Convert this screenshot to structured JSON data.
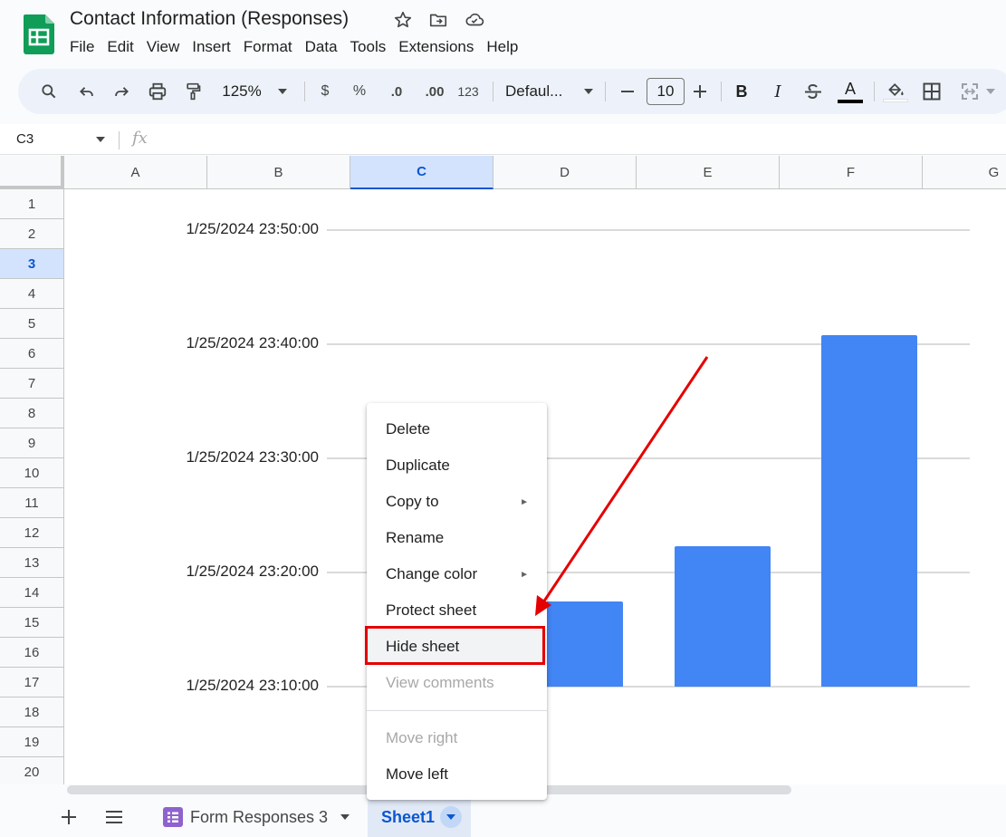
{
  "doc": {
    "title": "Contact Information (Responses)"
  },
  "menu": [
    "File",
    "Edit",
    "View",
    "Insert",
    "Format",
    "Data",
    "Tools",
    "Extensions",
    "Help"
  ],
  "toolbar": {
    "zoom": "125%",
    "currency": "$",
    "percent": "%",
    "dec_decrease": ".0",
    "dec_increase": ".00",
    "number_format": "123",
    "font": "Defaul...",
    "font_size": "10",
    "text_color": "A"
  },
  "formula_bar": {
    "cell_ref": "C3",
    "fx": "fx"
  },
  "columns": [
    "A",
    "B",
    "C",
    "D",
    "E",
    "F",
    "G"
  ],
  "selected_column": "C",
  "rows": [
    "1",
    "2",
    "3",
    "4",
    "5",
    "6",
    "7",
    "8",
    "9",
    "10",
    "11",
    "12",
    "13",
    "14",
    "15",
    "16",
    "17",
    "18",
    "19",
    "20"
  ],
  "selected_row": "3",
  "chart_data": {
    "type": "bar",
    "y_tick_labels": [
      "1/25/2024 23:50:00",
      "1/25/2024 23:40:00",
      "1/25/2024 23:30:00",
      "1/25/2024 23:20:00",
      "1/25/2024 23:10:00"
    ],
    "ylim": [
      "1/25/2024 23:10:00",
      "1/25/2024 23:50:00"
    ],
    "series": [
      {
        "values": [
          "1/25/2024 23:17:30",
          "1/25/2024 23:22:20",
          "1/25/2024 23:40:50"
        ]
      }
    ],
    "color": "#4285f4",
    "grid": true
  },
  "context_menu": {
    "items": [
      {
        "label": "Delete",
        "enabled": true
      },
      {
        "label": "Duplicate",
        "enabled": true
      },
      {
        "label": "Copy to",
        "enabled": true,
        "submenu": true
      },
      {
        "label": "Rename",
        "enabled": true
      },
      {
        "label": "Change color",
        "enabled": true,
        "submenu": true
      },
      {
        "label": "Protect sheet",
        "enabled": true
      },
      {
        "label": "Hide sheet",
        "enabled": true,
        "highlighted": true
      },
      {
        "label": "View comments",
        "enabled": false
      },
      {
        "label": "Move right",
        "enabled": false
      },
      {
        "label": "Move left",
        "enabled": true
      }
    ],
    "submenu_glyph": "►"
  },
  "sheet_tabs": [
    {
      "label": "Form Responses 3",
      "active": false
    },
    {
      "label": "Sheet1",
      "active": true
    }
  ],
  "colors": {
    "accent": "#0b57d0",
    "bar": "#4285f4",
    "annotation": "#e50000",
    "sheets_green": "#0f9d58"
  }
}
